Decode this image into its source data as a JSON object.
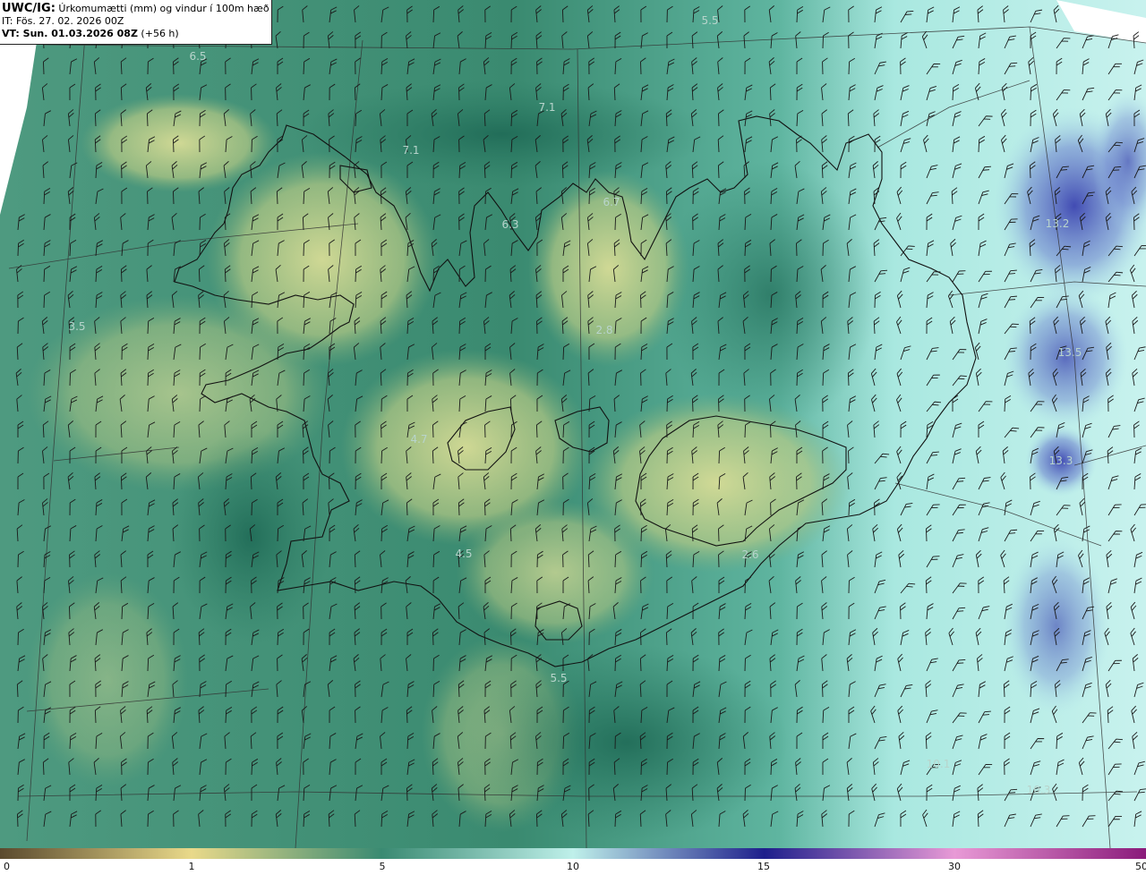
{
  "header": {
    "line1_bold": "UWC/IG:",
    "line1_rest": " Úrkomumætti (mm) og vindur í 100m hæð",
    "line2": "IT: Fös. 27. 02. 2026 00Z",
    "line3_bold": "VT: Sun. 01.03.2026 08Z",
    "line3_rest": " (+56 h)"
  },
  "map_labels": [
    "5.5",
    "6.5",
    "7.1",
    "7.1",
    "6.7",
    "6.3",
    "2.8",
    "3.5",
    "4.7",
    "4.5",
    "5.5",
    "2.6",
    "13.2",
    "13.5",
    "13.3",
    "10.1",
    "10.3"
  ],
  "colorbar": {
    "ticks": [
      "0",
      "1",
      "5",
      "10",
      "15",
      "30",
      "50"
    ],
    "colors": {
      "c0": "#5a4a2e",
      "c1": "#e9d98a",
      "c5": "#3a8a72",
      "c10": "#bff0ea",
      "c15": "#1e1f8c",
      "c30": "#e89ad6",
      "c50": "#8a1a7a"
    }
  },
  "colors": {
    "land_yellow": "#c9d68c",
    "sea_green": "#2f7f68",
    "sea_light": "#a8e6df",
    "high_blue": "#4a58b8",
    "coast_line": "#111111",
    "barb": "#1a1a1a"
  }
}
